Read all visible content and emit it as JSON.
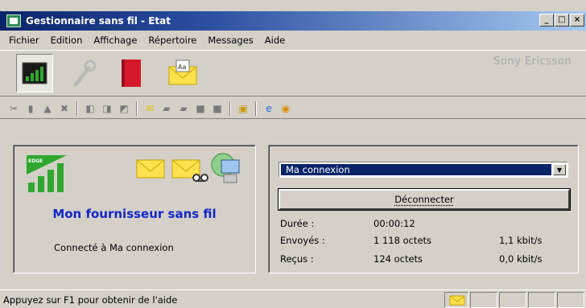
{
  "window": {
    "title": "Gestionnaire sans fil - Etat",
    "controls": {
      "minimize": "_",
      "maximize": "□",
      "close": "×"
    }
  },
  "menu": [
    "Fichier",
    "Edition",
    "Affichage",
    "Répertoire",
    "Messages",
    "Aide"
  ],
  "toolbar": {
    "brand": "Sony Ericsson",
    "buttons": [
      "signal-status-icon",
      "wrench-settings-icon",
      "red-book-icon",
      "envelope-aa-icon"
    ]
  },
  "small_toolbar": [
    "cut-icon",
    "copy-icon",
    "paste-icon",
    "delete-icon",
    "reply-icon",
    "reply-all-icon",
    "forward-icon",
    "new-message-icon",
    "folder-icon",
    "folder-up-icon",
    "send-icon",
    "receive-icon",
    "address-book-icon",
    "internet-explorer-icon",
    "clock-icon"
  ],
  "status_panel": {
    "network_badge": "EDGE",
    "provider": "Mon fournisseur sans fil",
    "connection_status": "Connecté à Ma connexion"
  },
  "connection_panel": {
    "selected_connection": "Ma connexion",
    "disconnect_label": "Déconnecter",
    "stats": [
      {
        "label": "Durée :",
        "value": "00:00:12",
        "rate": ""
      },
      {
        "label": "Envoyés :",
        "value": "1 118 octets",
        "rate": "1,1 kbit/s"
      },
      {
        "label": "Reçus :",
        "value": "124 octets",
        "rate": "0,0 kbit/s"
      }
    ]
  },
  "statusbar": {
    "help_text": "Appuyez sur F1 pour obtenir de l'aide"
  },
  "colors": {
    "accent_blue": "#0a246a",
    "provider_blue": "#1428c8",
    "signal_green": "#2fa82f",
    "envelope_yellow": "#ffe14d"
  }
}
